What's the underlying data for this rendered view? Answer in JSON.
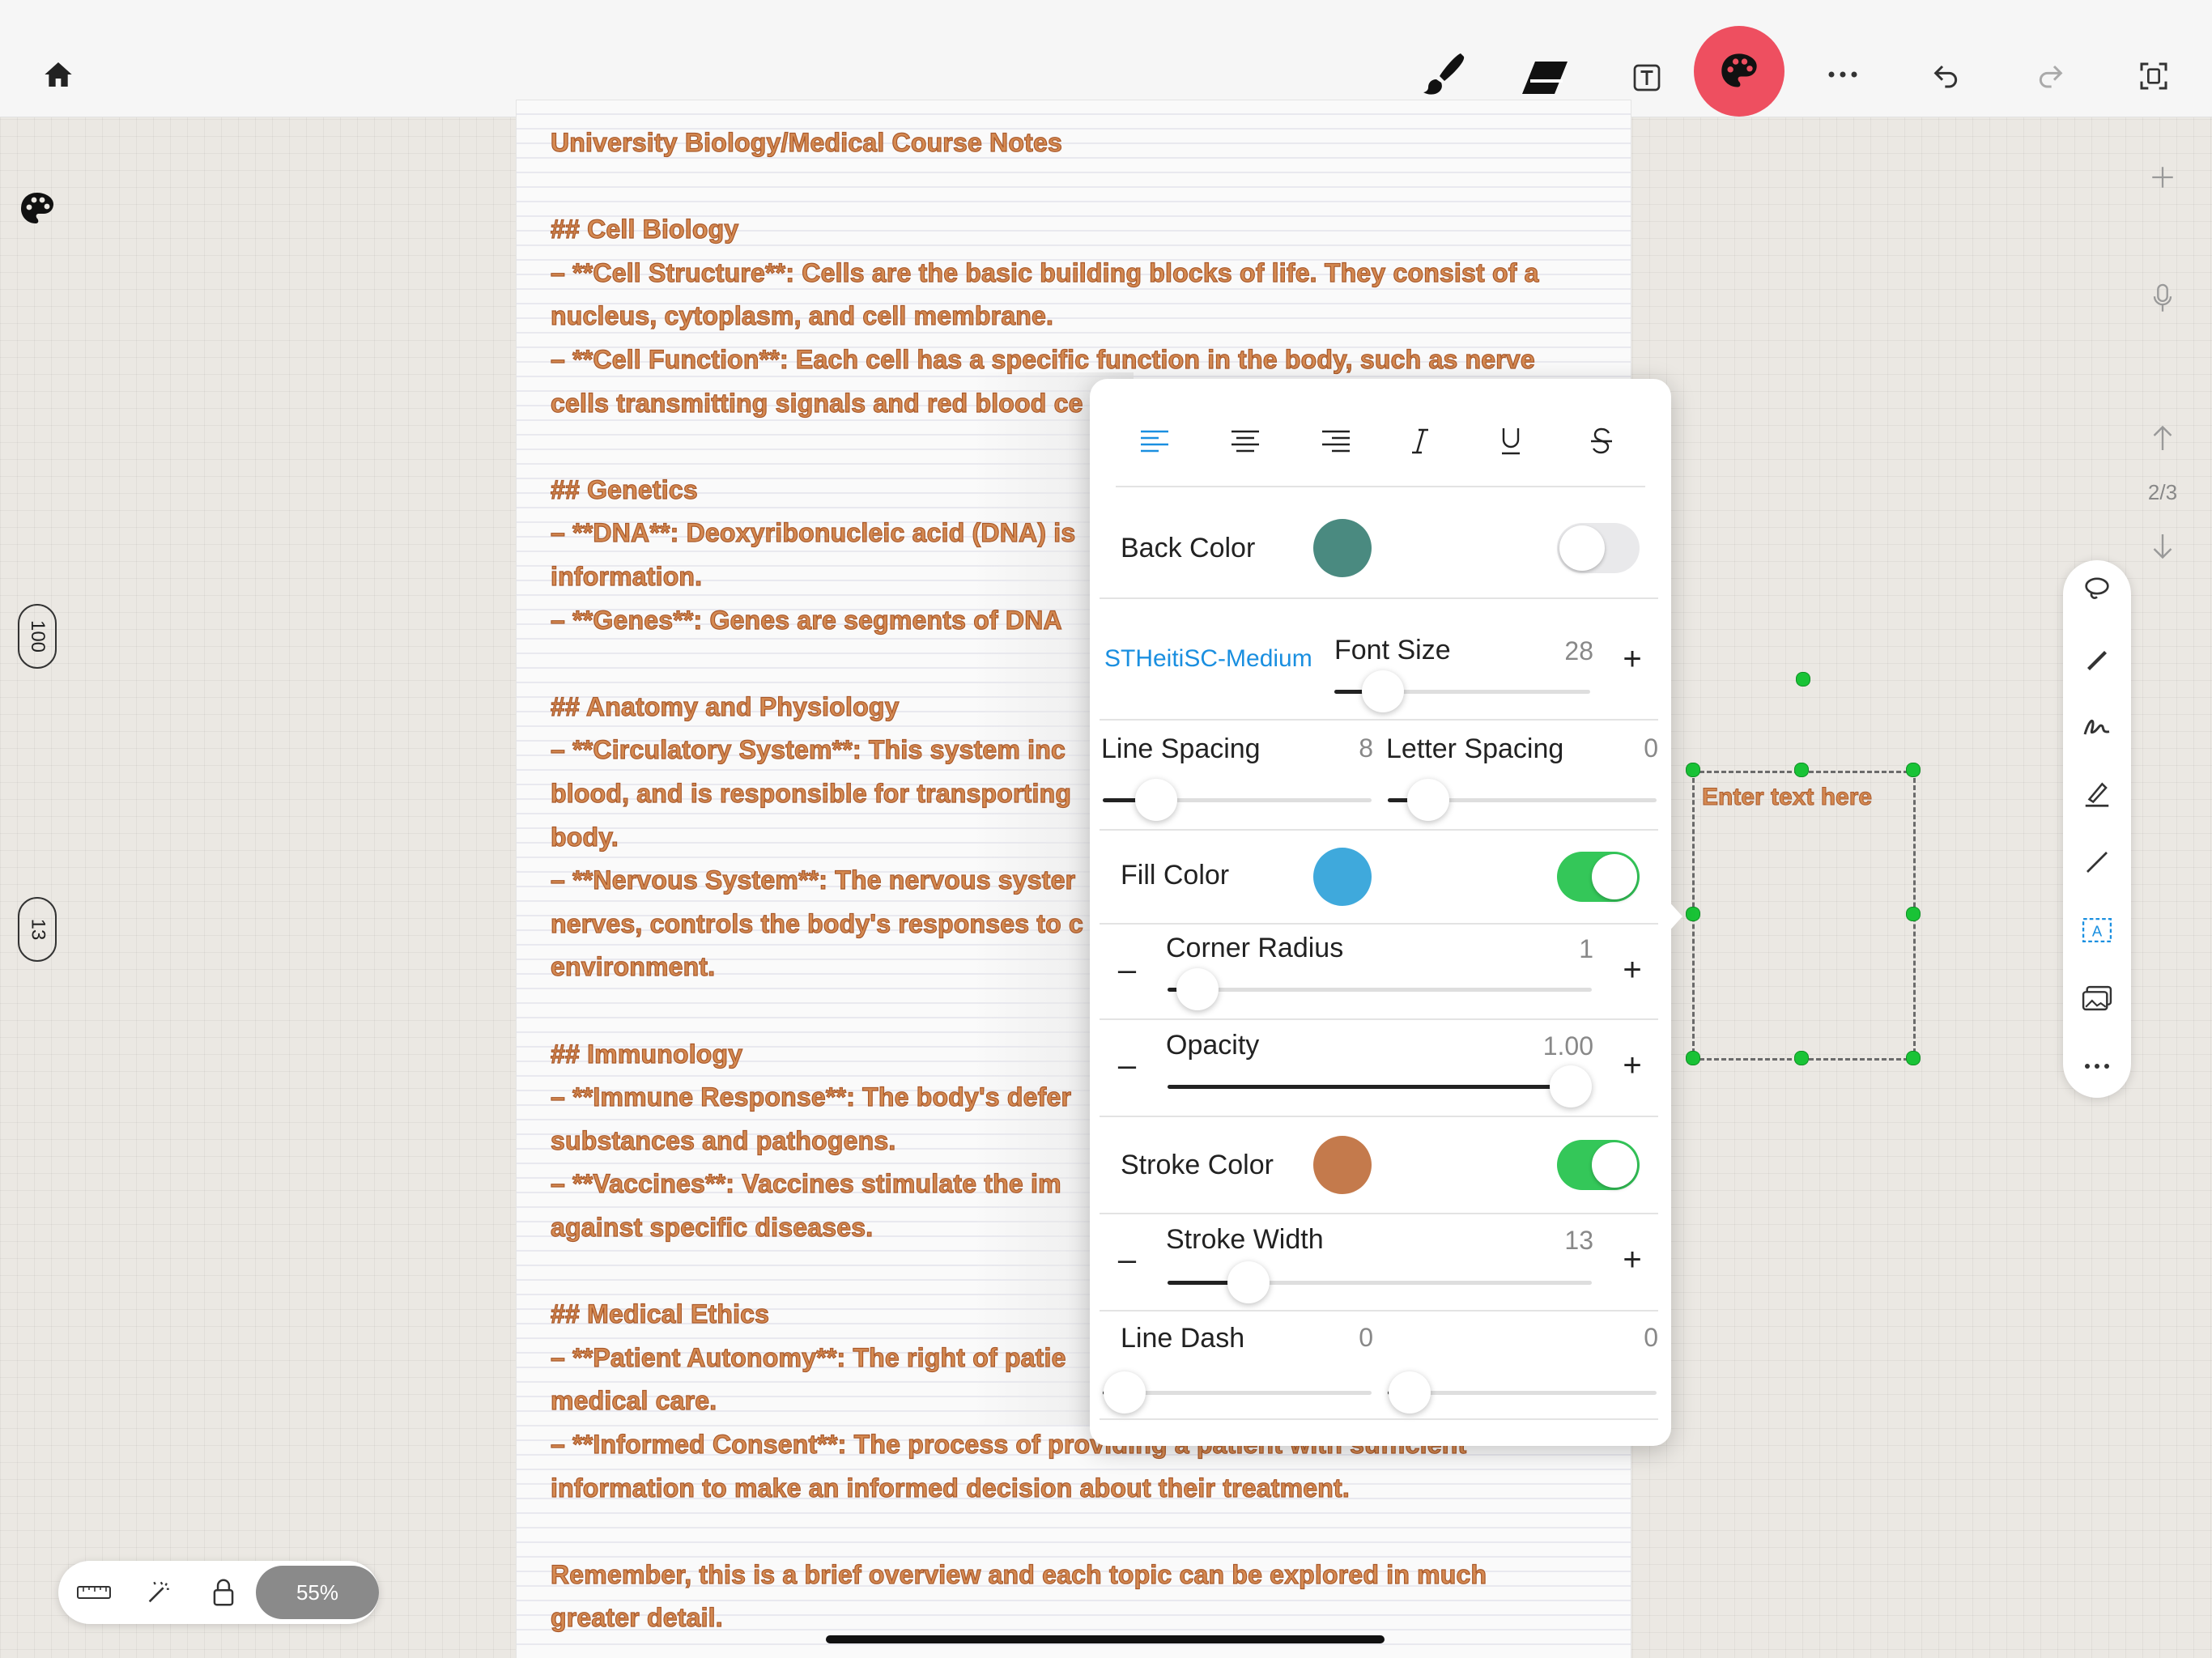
{
  "toolbar": {
    "items": [
      "home-icon",
      "brush-icon",
      "eraser-icon",
      "text-tool-icon",
      "palette-icon",
      "more-icon",
      "undo-icon",
      "redo-icon",
      "screen-capture-icon"
    ],
    "accent": "#ee4f60"
  },
  "left_rail": {
    "pill_top": "100",
    "pill_bottom": "13"
  },
  "right_rail": {
    "page_indicator": "2/3"
  },
  "bottom_left": {
    "zoom": "55%"
  },
  "note": {
    "lines": [
      "University Biology/Medical Course Notes",
      "",
      "## Cell Biology",
      "– **Cell Structure**: Cells are the basic building blocks of life. They consist of a",
      "nucleus, cytoplasm, and cell membrane.",
      "– **Cell Function**: Each cell has a specific function in the body, such as nerve",
      "cells transmitting signals and red blood ce",
      "",
      "## Genetics",
      "– **DNA**: Deoxyribonucleic acid (DNA) is",
      "information.",
      "– **Genes**: Genes are segments of DNA",
      "",
      "## Anatomy and Physiology",
      "– **Circulatory System**: This system inc",
      "blood, and is responsible for transporting",
      "body.",
      "– **Nervous System**: The nervous syster",
      "nerves, controls the body's responses to c",
      "environment.",
      "",
      "## Immunology",
      "– **Immune Response**: The body's defer",
      "substances and pathogens.",
      "– **Vaccines**: Vaccines stimulate the im",
      "against specific diseases.",
      "",
      "## Medical Ethics",
      "– **Patient Autonomy**: The right of patie",
      "medical care.",
      "– **Informed Consent**: The process of providing a patient with sufficient",
      "information to make an informed decision about their treatment.",
      "",
      "Remember, this is a brief overview and each topic can be explored in much",
      "greater detail."
    ],
    "text_color": "#d58a52"
  },
  "textbox": {
    "placeholder": "Enter text here"
  },
  "panel": {
    "back_color": {
      "label": "Back Color",
      "color": "#4a8a80",
      "enabled": false
    },
    "font": {
      "name": "STHeitiSC-Medium",
      "size_label": "Font Size",
      "size_value": "28",
      "size_level": 0.19
    },
    "line_spacing": {
      "label": "Line Spacing",
      "value": "8",
      "level": 0.2
    },
    "letter_spacing": {
      "label": "Letter Spacing",
      "value": "0",
      "level": 0.15
    },
    "fill_color": {
      "label": "Fill Color",
      "color": "#3fa9dc",
      "enabled": true
    },
    "corner_radius": {
      "label": "Corner Radius",
      "value": "1",
      "level": 0.07
    },
    "opacity": {
      "label": "Opacity",
      "value": "1.00",
      "level": 0.95
    },
    "stroke_color": {
      "label": "Stroke Color",
      "color": "#c47a4c",
      "enabled": true
    },
    "stroke_width": {
      "label": "Stroke Width",
      "value": "13",
      "level": 0.19
    },
    "line_dash": {
      "label": "Line Dash",
      "value_a": "0",
      "value_b": "0",
      "level_a": 0.08,
      "level_b": 0.08
    },
    "alignment_selected": "left",
    "accent_blue": "#1a8fe0",
    "toggle_green": "#34c759"
  }
}
